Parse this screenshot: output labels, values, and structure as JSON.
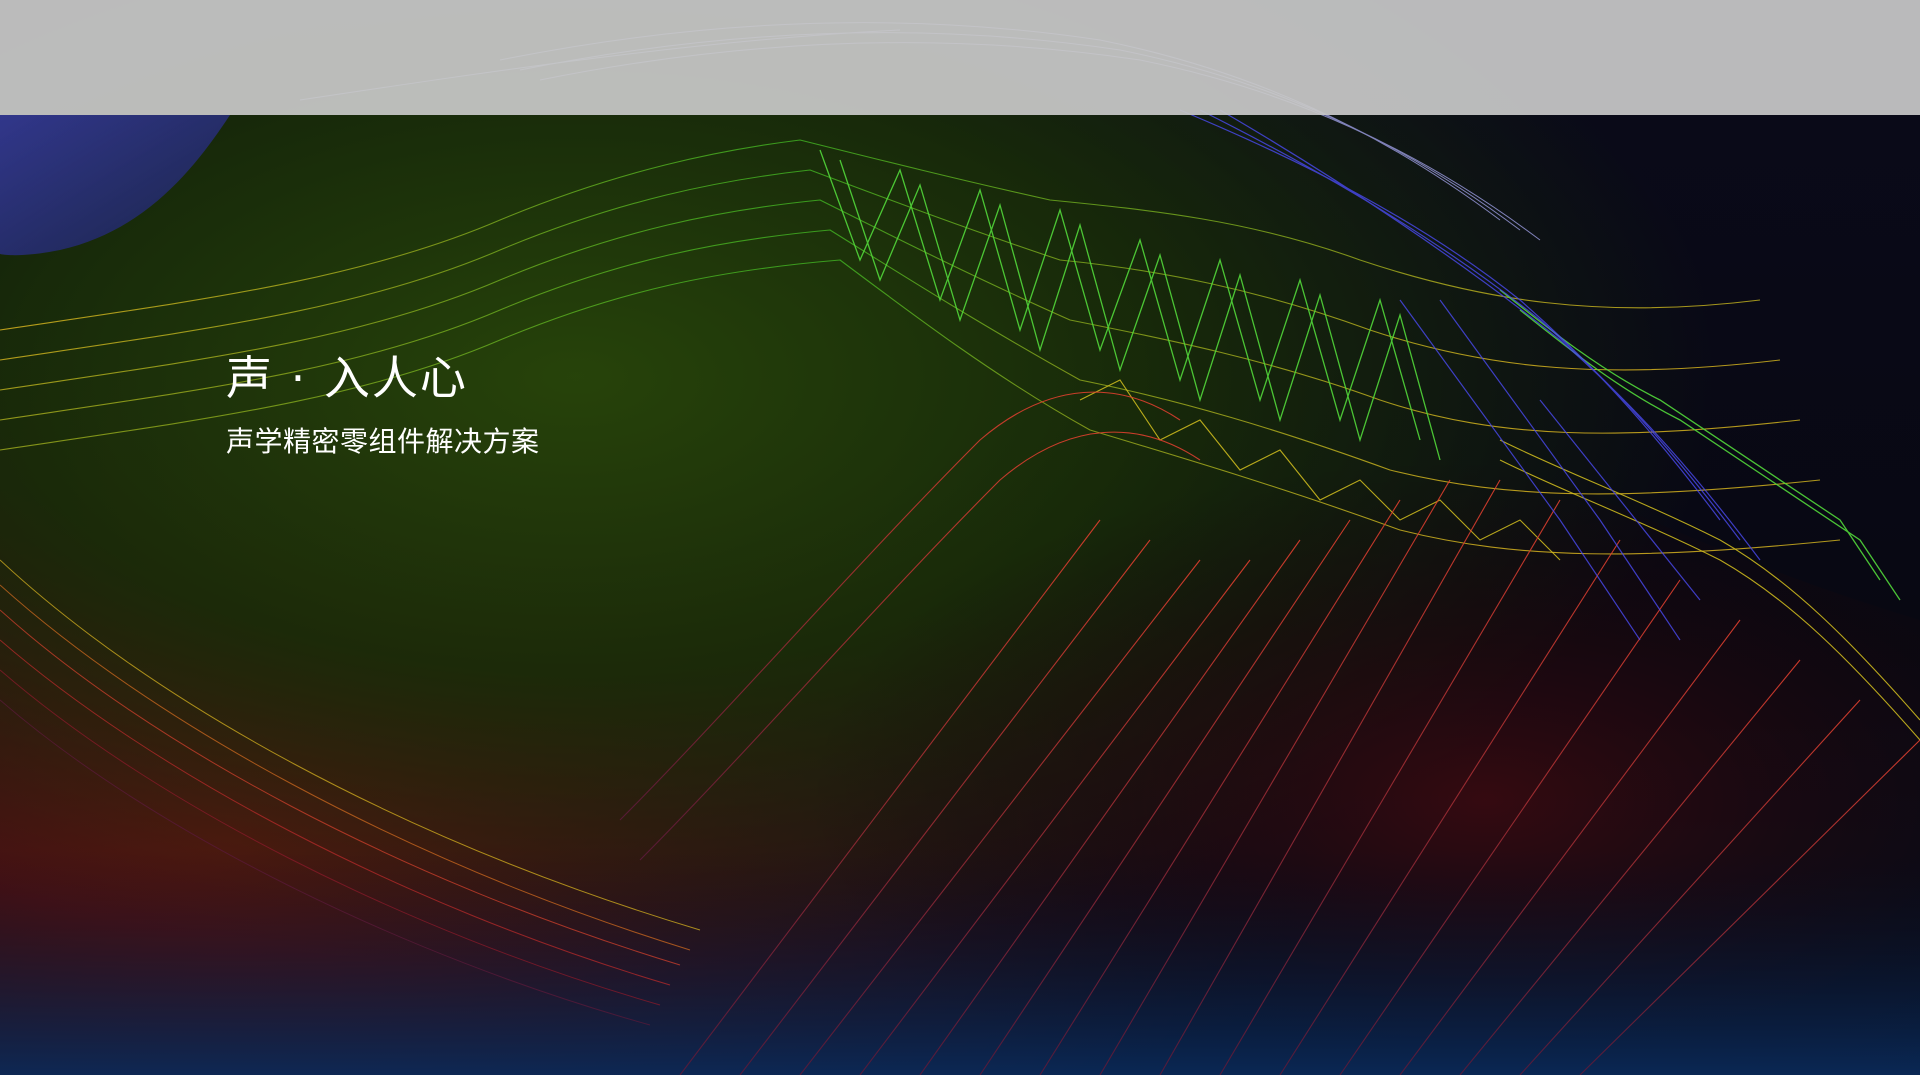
{
  "hero": {
    "title": "声 · 入人心",
    "subtitle": "声学精密零组件解决方案"
  },
  "theme": {
    "top_bar_color": "#c8c8c8",
    "text_color": "#ffffff",
    "wave_colors": [
      "#2a8a1a",
      "#4fd12f",
      "#d6c21f",
      "#e0382e",
      "#3a3ad8",
      "#b0b0ff"
    ]
  }
}
